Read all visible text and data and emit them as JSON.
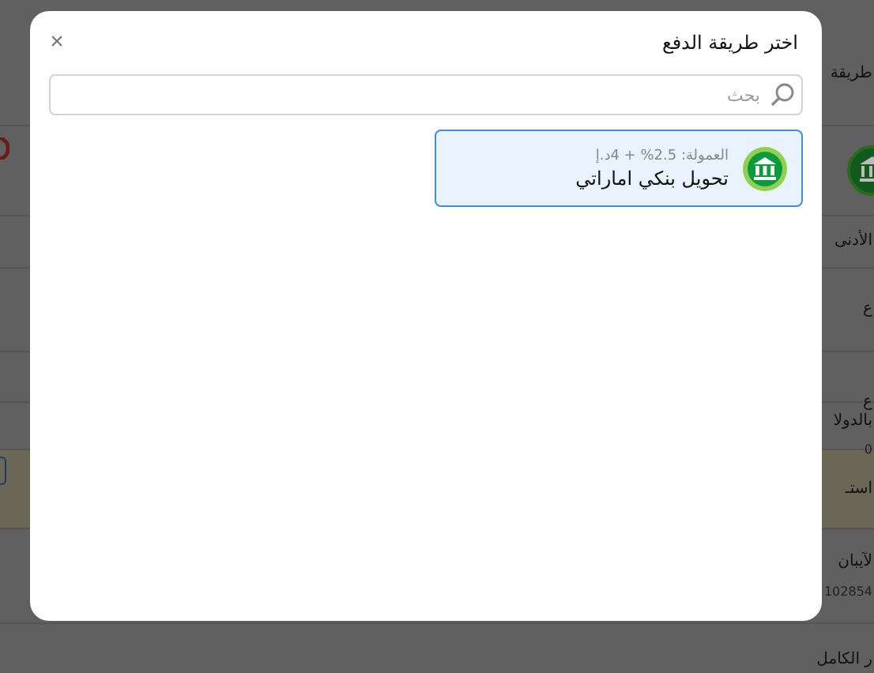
{
  "background": {
    "rows": [
      {
        "kind": "text",
        "text": "طريقة"
      },
      {
        "kind": "icon"
      },
      {
        "kind": "text",
        "text": "الأدنى"
      },
      {
        "kind": "text",
        "text": "ع"
      },
      {
        "kind": "blank"
      },
      {
        "kind": "pair",
        "text": "ع بالدولا",
        "value": "0"
      },
      {
        "kind": "notice",
        "text": "استـ"
      },
      {
        "kind": "pair",
        "text": "لآيبان",
        "value": "102854"
      },
      {
        "kind": "text",
        "text": "ر الكامل"
      }
    ]
  },
  "modal": {
    "title": "اختر طريقة الدفع",
    "close": "×",
    "search": {
      "placeholder": "بحث"
    },
    "options": [
      {
        "name": "تحويل بنكي اماراتي",
        "fee": "العمولة: 2.5% + 4د.إ",
        "selected": true
      }
    ]
  }
}
